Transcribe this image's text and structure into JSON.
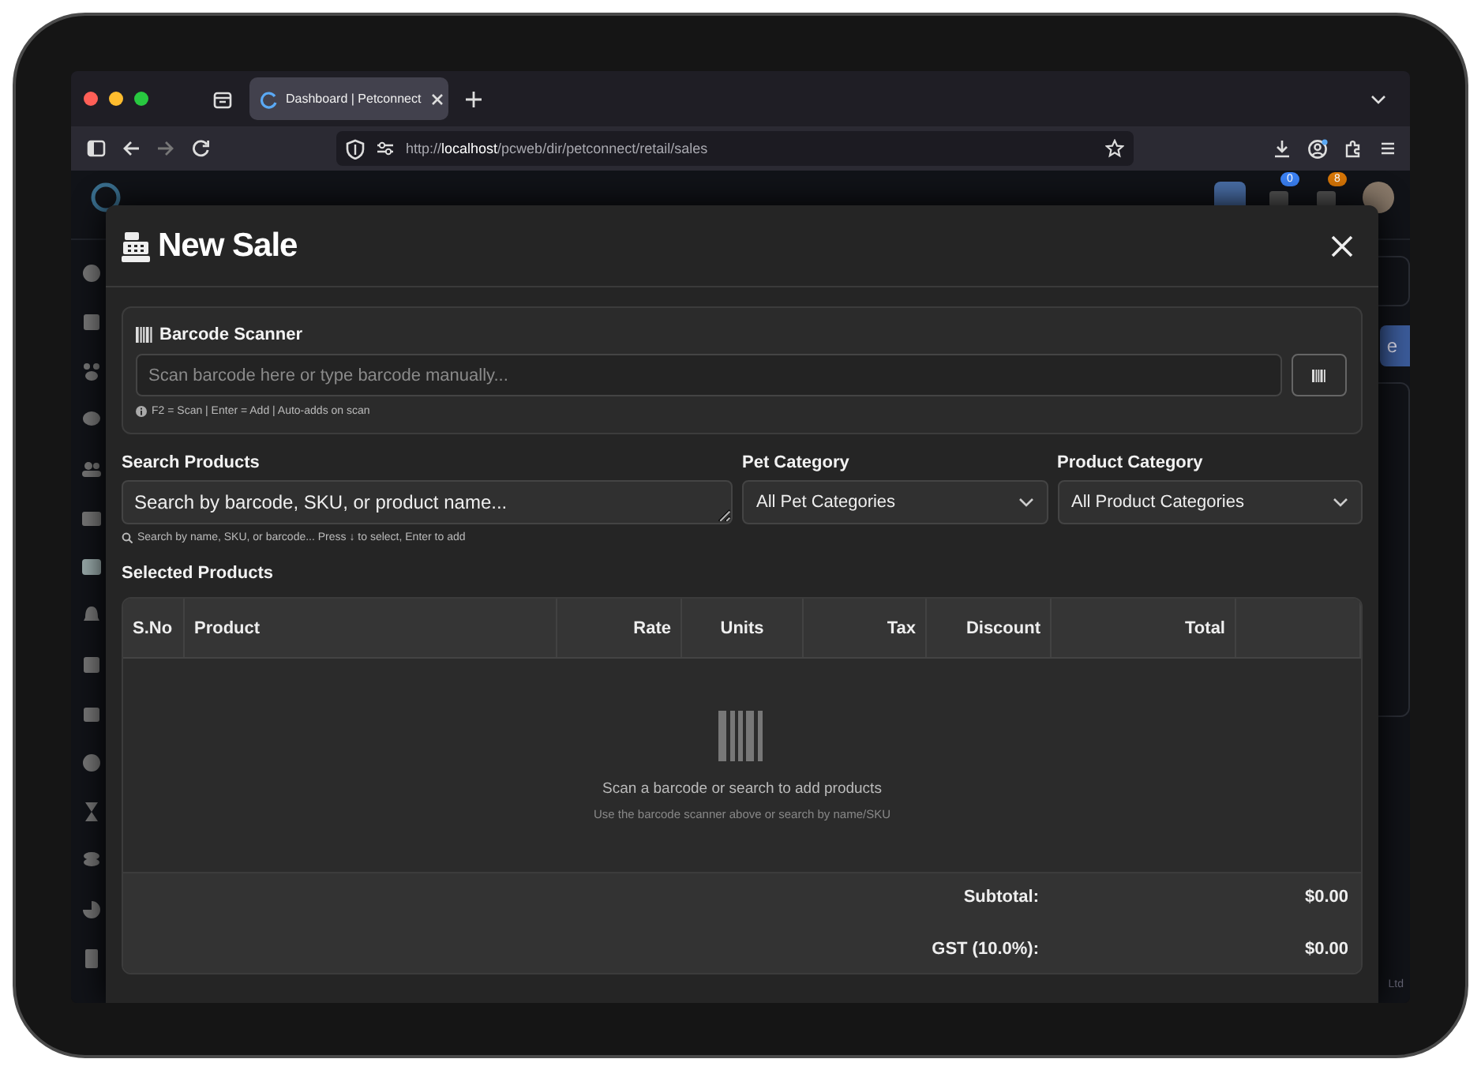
{
  "browser": {
    "tab": {
      "title": "Dashboard | Petconnect",
      "selected": true
    },
    "url": {
      "scheme": "http://",
      "host": "localhost",
      "path": "/pcweb/dir/petconnect/retail/sales"
    }
  },
  "background_page": {
    "badges": [
      {
        "count": "0",
        "color": "#3b82f6"
      },
      {
        "count": "8",
        "color": "#d97706"
      }
    ],
    "action_button": "e",
    "footer_text": "Ltd"
  },
  "modal": {
    "title": "New Sale",
    "barcode_scanner": {
      "title": "Barcode Scanner",
      "placeholder": "Scan barcode here or type barcode manually...",
      "hint": "F2 = Scan | Enter = Add | Auto-adds on scan"
    },
    "search": {
      "label": "Search Products",
      "placeholder": "Search by barcode, SKU, or product name...",
      "hint": "Search by name, SKU, or barcode... Press ↓ to select, Enter to add"
    },
    "filters": [
      {
        "label": "Pet Category",
        "value": "All Pet Categories"
      },
      {
        "label": "Product Category",
        "value": "All Product Categories"
      }
    ],
    "selected_products": {
      "title": "Selected Products",
      "columns": [
        {
          "label": "S.No"
        },
        {
          "label": "Product"
        },
        {
          "label": "Rate"
        },
        {
          "label": "Units"
        },
        {
          "label": "Tax"
        },
        {
          "label": "Discount"
        },
        {
          "label": "Total"
        }
      ],
      "empty": {
        "message": "Scan a barcode or search to add products",
        "hint": "Use the barcode scanner above or search by name/SKU"
      }
    },
    "totals": [
      {
        "label": "Subtotal:",
        "value": "$0.00"
      },
      {
        "label": "GST (10.0%):",
        "value": "$0.00"
      }
    ]
  }
}
